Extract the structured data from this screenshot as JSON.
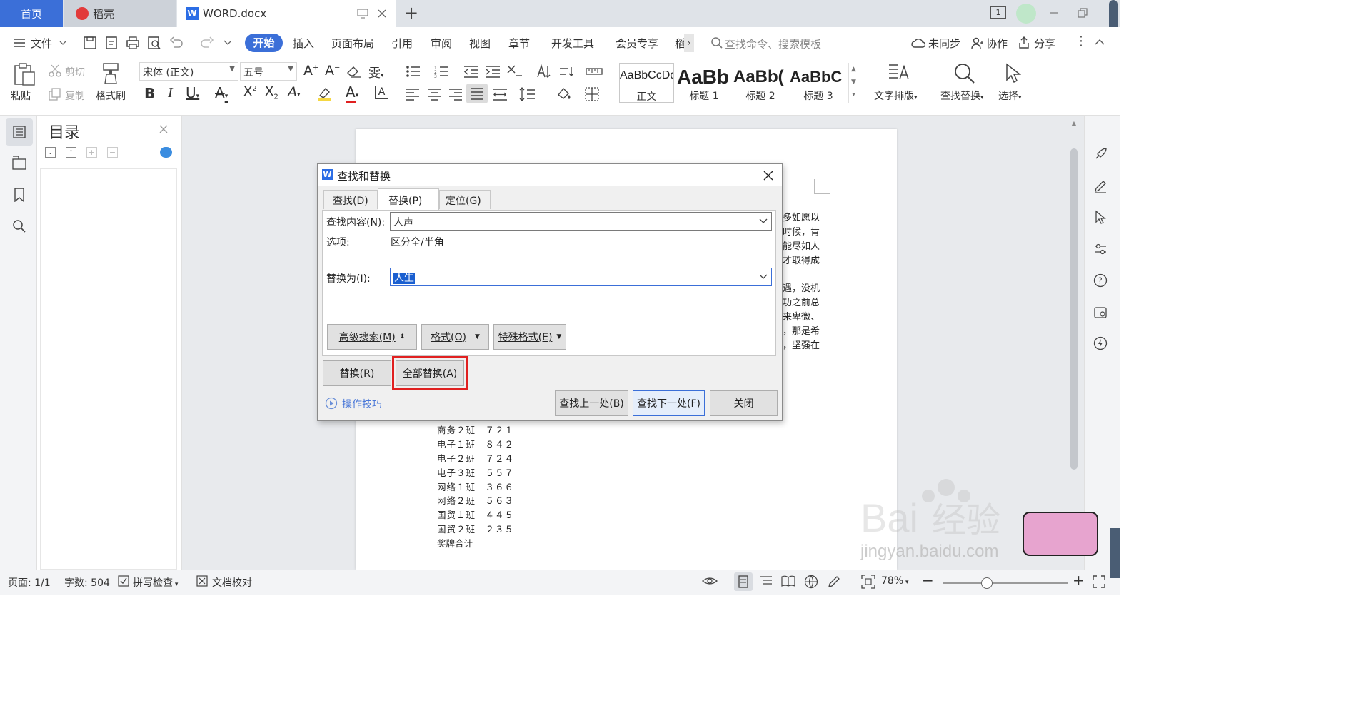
{
  "tabs": {
    "home": "首页",
    "daoke": "稻壳",
    "doc": "WORD.docx",
    "new_tab": "+"
  },
  "titlebar_right": {
    "badge": "1"
  },
  "menu": {
    "file": "文件",
    "items": [
      "开始",
      "插入",
      "页面布局",
      "引用",
      "审阅",
      "视图",
      "章节",
      "开发工具",
      "会员专享",
      "稻"
    ],
    "search_placeholder": "查找命令、搜索模板",
    "unsynced": "未同步",
    "collab": "协作",
    "share": "分享"
  },
  "ribbon": {
    "paste": "粘贴",
    "cut": "剪切",
    "copy": "复制",
    "format_painter": "格式刷",
    "font_name": "宋体 (正文)",
    "font_size": "五号",
    "styles": [
      {
        "preview": "AaBbCcDd",
        "label": "正文"
      },
      {
        "preview": "AaBb",
        "label": "标题 1"
      },
      {
        "preview": "AaBb(",
        "label": "标题 2"
      },
      {
        "preview": "AaBbC",
        "label": "标题 3"
      }
    ],
    "text_layout": "文字排版",
    "find_replace": "查找替换",
    "select": "选择"
  },
  "toc": {
    "title": "目录"
  },
  "document": {
    "partial_lines": [
      "多如愿以",
      "时候，肯",
      "能尽如人",
      "才取得成",
      "遇，没机",
      "功之前总",
      "来卑微、",
      "，那是希",
      "，坚强在"
    ],
    "table_rows": [
      "商务２班　７２１",
      "电子１班　８４２",
      "电子２班　７２４",
      "电子３班　５５７",
      "网络１班　３６６",
      "网络２班　５６３",
      "国贸１班　４４５",
      "国贸２班　２３５",
      "奖牌合计"
    ]
  },
  "dialog": {
    "title": "查找和替换",
    "tabs": [
      "查找(D)",
      "替换(P)",
      "定位(G)"
    ],
    "find_label": "查找内容(N):",
    "find_value": "人声",
    "options_label": "选项:",
    "options_value": "区分全/半角",
    "replace_label": "替换为(I):",
    "replace_value": "人生",
    "advanced_btn": "高级搜索(M)",
    "format_btn": "格式(O)",
    "special_btn": "特殊格式(E)",
    "replace_btn": "替换(R)",
    "replace_all_btn": "全部替换(A)",
    "tips_link": "操作技巧",
    "find_prev_btn": "查找上一处(B)",
    "find_next_btn": "查找下一处(F)",
    "close_btn": "关闭",
    "highlight_color": "#e02020"
  },
  "status": {
    "page": "页面: 1/1",
    "words": "字数: 504",
    "spell": "拼写检查",
    "proof": "文档校对",
    "zoom": "78%"
  },
  "watermark": {
    "text": "jingyan.baidu.com"
  },
  "colors": {
    "accent": "#2b6de5",
    "tabbar": "#dfe3e8",
    "dialog_bg": "#f0f0f0"
  }
}
